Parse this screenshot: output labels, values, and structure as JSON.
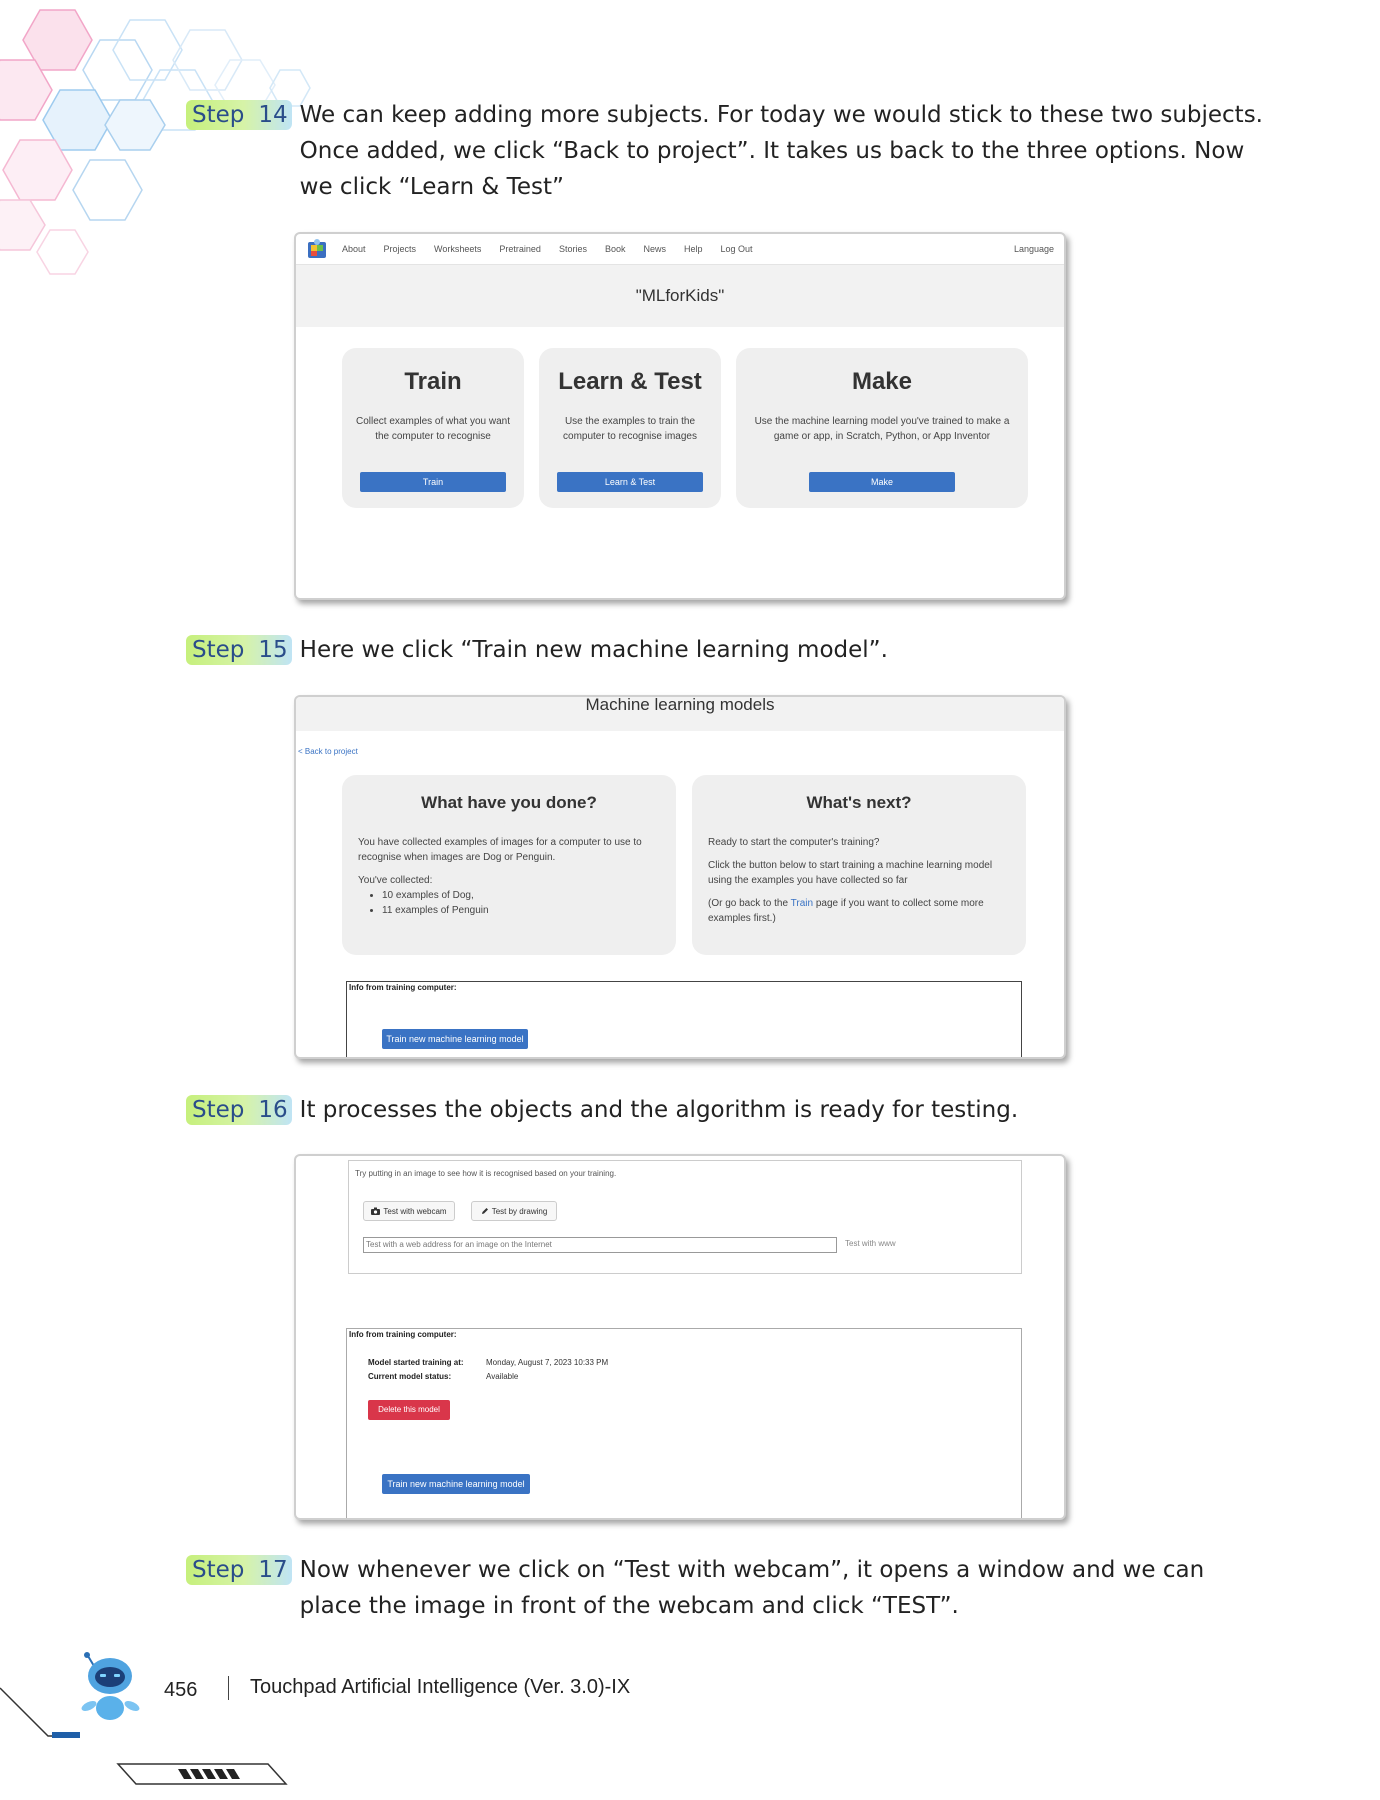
{
  "steps": [
    {
      "label": "Step",
      "num": "14",
      "text": "We can keep adding more subjects. For today we would stick to these two subjects. Once added, we click “Back to project”. It takes us back to the three options. Now we click “Learn & Test”"
    },
    {
      "label": "Step",
      "num": "15",
      "text": "Here we click “Train new machine learning model”."
    },
    {
      "label": "Step",
      "num": "16",
      "text": "It processes the objects and the algorithm is ready for testing."
    },
    {
      "label": "Step",
      "num": "17",
      "text": "Now whenever we click on “Test with webcam”, it opens a window and we can place the image in front of the webcam and click “TEST”."
    }
  ],
  "shot1": {
    "nav": [
      "About",
      "Projects",
      "Worksheets",
      "Pretrained",
      "Stories",
      "Book",
      "News",
      "Help",
      "Log Out"
    ],
    "language": "Language",
    "project_title": "\"MLforKids\"",
    "cards": [
      {
        "title": "Train",
        "desc": "Collect examples of what you want the computer to recognise",
        "button": "Train"
      },
      {
        "title": "Learn & Test",
        "desc": "Use the examples to train the computer to recognise images",
        "button": "Learn & Test"
      },
      {
        "title": "Make",
        "desc": "Use the machine learning model you've trained to make a game or app, in Scratch, Python, or App Inventor",
        "button": "Make"
      }
    ]
  },
  "shot2": {
    "title": "Machine learning models",
    "back_link": "< Back to project",
    "done": {
      "title": "What have you done?",
      "desc": "You have collected examples of images for a computer to use to recognise when images are Dog or Penguin.",
      "collected_label": "You've collected:",
      "items": [
        "10 examples of Dog,",
        "11 examples of Penguin"
      ]
    },
    "next": {
      "title": "What's next?",
      "p1": "Ready to start the computer's training?",
      "p2": "Click the button below to start training a machine learning model using the examples you have collected so far",
      "p3_a": "(Or go back to the ",
      "p3_link": "Train",
      "p3_b": " page if you want to collect some more examples first.)"
    },
    "info_label": "Info from training computer:",
    "train_button": "Train new machine learning model"
  },
  "shot3": {
    "try_text": "Try putting in an image to see how it is recognised based on your training.",
    "webcam_button": "Test with webcam",
    "drawing_button": "Test by drawing",
    "url_placeholder": "Test with a web address for an image on the Internet",
    "test_www": "Test with www",
    "info_label": "Info from training computer:",
    "started_label": "Model started training at:",
    "started_value": "Monday, August 7, 2023 10:33 PM",
    "status_label": "Current model status:",
    "status_value": "Available",
    "delete_button": "Delete this model",
    "train_button": "Train new machine learning model"
  },
  "footer": {
    "page_number": "456",
    "book_title": "Touchpad Artificial Intelligence (Ver. 3.0)-IX"
  },
  "colors": {
    "accent_blue": "#3a73c4",
    "danger_red": "#d9364a",
    "step_green": "#c6f07c"
  }
}
